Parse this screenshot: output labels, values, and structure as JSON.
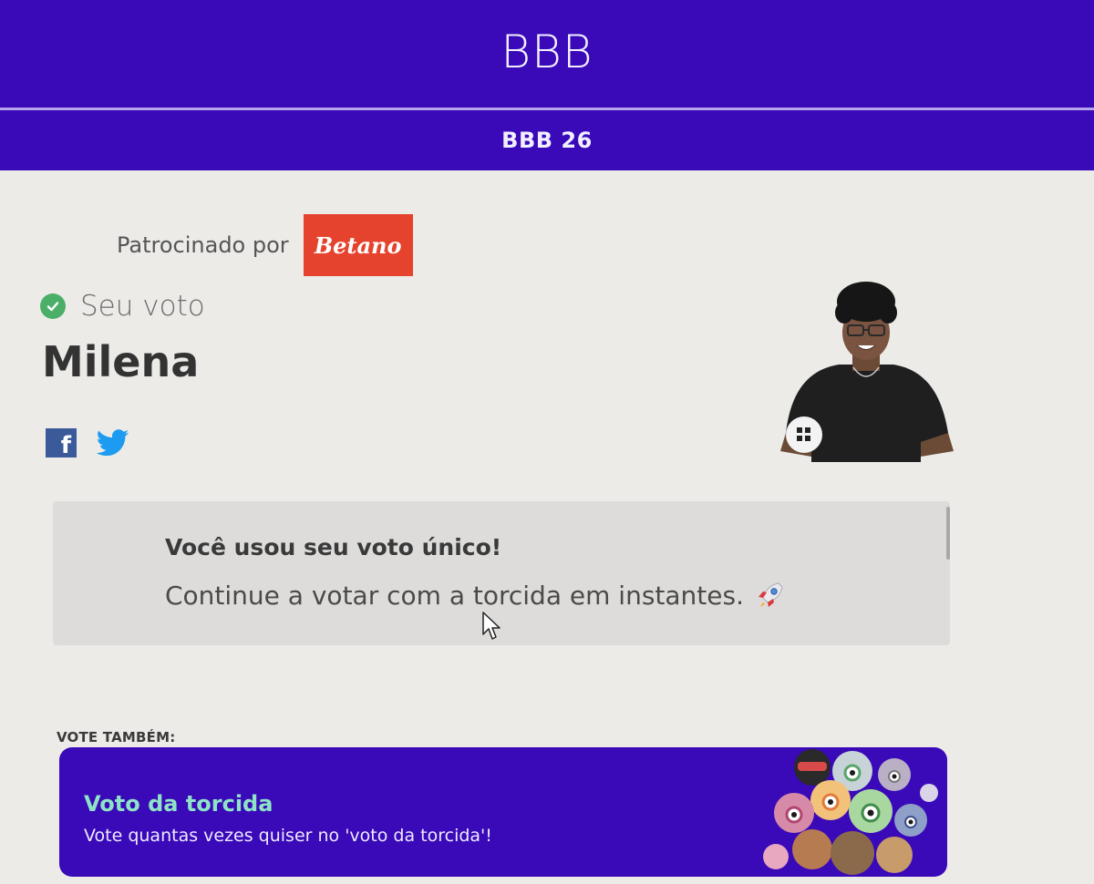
{
  "header": {
    "brand": "BBB",
    "edition": "BBB 26"
  },
  "sponsor": {
    "label": "Patrocinado por",
    "logo_text": "Betano"
  },
  "vote": {
    "status_label": "Seu voto",
    "name": "Milena"
  },
  "social": {
    "icons": [
      "facebook-icon",
      "twitter-icon"
    ]
  },
  "message": {
    "title": "Você usou seu voto único!",
    "subtitle": "Continue a votar com a torcida em instantes."
  },
  "vote_also": {
    "label": "VOTE TAMBÉM:",
    "card": {
      "title": "Voto da torcida",
      "description": "Vote quantas vezes quiser no 'voto da torcida'!"
    }
  },
  "colors": {
    "brand_purple": "#3a09b8",
    "sponsor_red": "#e5432d",
    "check_green": "#4caf68",
    "card_title_green": "#8ee3c6"
  }
}
